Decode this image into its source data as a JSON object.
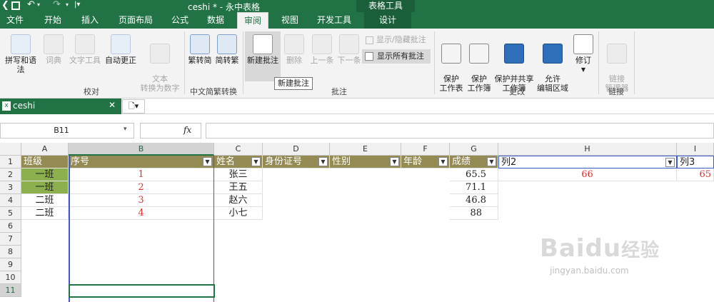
{
  "titlebar": {
    "title": "ceshi * - 永中表格",
    "context_tab": "表格工具"
  },
  "tabs": [
    "文件",
    "开始",
    "插入",
    "页面布局",
    "公式",
    "数据",
    "审阅",
    "视图",
    "开发工具",
    "设计"
  ],
  "ribbon": {
    "buttons": [
      "拼写和语法",
      "词典",
      "文字工具",
      "自动更正",
      "文本\n转换为数字",
      "繁转简",
      "简转繁",
      "新建批注",
      "删除",
      "上一条",
      "下一条",
      "保护\n工作表",
      "保护\n工作簿",
      "保护并共享\n工作簿",
      "允许\n编辑区域",
      "修订",
      "链接\n管理器"
    ],
    "small": [
      "显示/隐藏批注",
      "显示所有批注"
    ],
    "groups": [
      "校对",
      "中文简繁转换",
      "批注",
      "更改",
      "链接"
    ],
    "tooltip": "新建批注"
  },
  "file_tab": {
    "name": "ceshi"
  },
  "formula_bar": {
    "name_box": "B11",
    "fx": "fx",
    "content": ""
  },
  "columns": [
    "A",
    "B",
    "C",
    "D",
    "E",
    "F",
    "G",
    "H",
    "I"
  ],
  "rows": [
    "1",
    "2",
    "3",
    "4",
    "5",
    "6",
    "7",
    "8",
    "9",
    "10",
    "11"
  ],
  "table": {
    "headers": [
      "班级",
      "序号",
      "姓名",
      "身份证号",
      "性别",
      "年龄",
      "成绩",
      "列2",
      "列3"
    ],
    "data": [
      [
        "一班",
        "1",
        "张三",
        "",
        "",
        "",
        "65.5",
        "66",
        "65"
      ],
      [
        "一班",
        "2",
        "王五",
        "",
        "",
        "",
        "71.1",
        "",
        ""
      ],
      [
        "二班",
        "3",
        "赵六",
        "",
        "",
        "",
        "46.8",
        "",
        ""
      ],
      [
        "二班",
        "4",
        "小七",
        "",
        "",
        "",
        "88",
        "",
        ""
      ]
    ]
  },
  "watermark": {
    "brand": "Baidu",
    "cn": "经验",
    "url": "jingyan.baidu.com"
  }
}
